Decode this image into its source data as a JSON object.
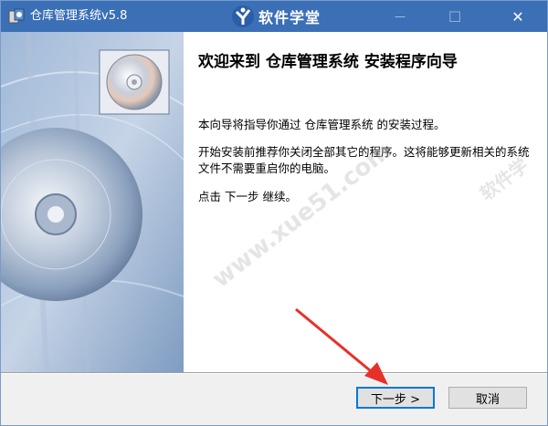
{
  "window": {
    "title": "仓库管理系统v5.8",
    "logo_text": "软件学堂",
    "minimize_glyph": "—",
    "maximize_glyph": "☐",
    "close_glyph": "✕"
  },
  "wizard": {
    "heading": "欢迎来到 仓库管理系统 安装程序向导",
    "paragraph1": "本向导将指导你通过 仓库管理系统 的安装过程。",
    "paragraph2": "开始安装前推荐你关闭全部其它的程序。这将能够更新相关的系统文件不需要重启你的电脑。",
    "paragraph3": "点击 下一步 继续。"
  },
  "buttons": {
    "next_label": "下一步 >",
    "cancel_label": "取消"
  },
  "watermarks": {
    "main": "www.xue51.com",
    "side": "软件学"
  },
  "colors": {
    "titlebar": "#3b6fb6",
    "focus_border": "#0078d7",
    "arrow": "#e8302a"
  }
}
